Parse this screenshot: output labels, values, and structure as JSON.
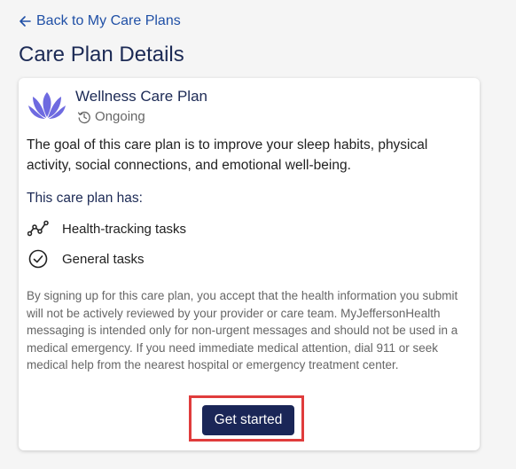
{
  "nav": {
    "back_label": "Back to My Care Plans",
    "back_icon": "arrow-left-icon"
  },
  "page": {
    "title": "Care Plan Details"
  },
  "plan": {
    "icon": "lotus-icon",
    "name": "Wellness Care Plan",
    "status": "Ongoing",
    "status_icon": "history-icon",
    "description": "The goal of this care plan is to improve your sleep habits, physical activity, social connections, and emotional well-being.",
    "has_heading": "This care plan has:",
    "tasks": [
      {
        "icon": "trend-line-icon",
        "label": "Health-tracking tasks"
      },
      {
        "icon": "check-circle-icon",
        "label": "General tasks"
      }
    ],
    "disclaimer": "By signing up for this care plan, you accept that the health information you submit will not be actively reviewed by your provider or care team. MyJeffersonHealth messaging is intended only for non-urgent messages and should not be used in a medical emergency. If you need immediate medical attention, dial 911 or seek medical help from the nearest hospital or emergency treatment center."
  },
  "actions": {
    "get_started_label": "Get started"
  },
  "colors": {
    "link": "#2050a6",
    "heading": "#1c2a55",
    "primary_button": "#1a2657",
    "lotus": "#6e6ae0",
    "highlight": "#e03c3c"
  }
}
